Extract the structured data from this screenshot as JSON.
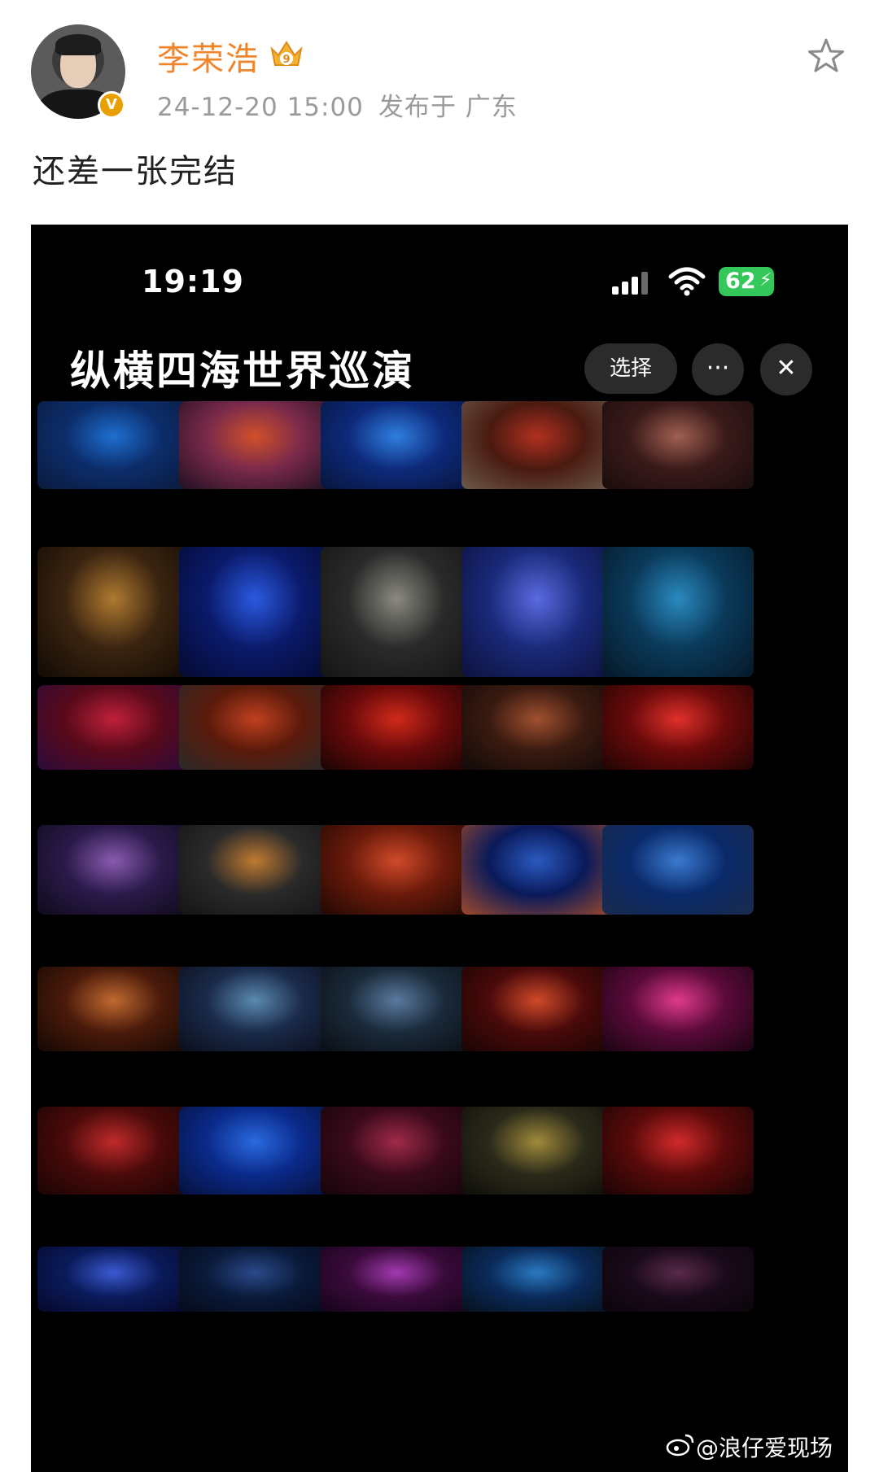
{
  "post": {
    "username": "李荣浩",
    "vip_level": "9",
    "verified_mark": "V",
    "date": "24-12-20 15:00",
    "location": "发布于 广东",
    "text": "还差一张完结"
  },
  "screenshot": {
    "status_time": "19:19",
    "battery": "62",
    "album_title": "纵横四海世界巡演",
    "select_label": "选择",
    "more_label": "···",
    "close_label": "✕",
    "thumbnails": [
      {
        "row": 0,
        "col": 0,
        "colors": [
          "#0c2d6b",
          "#1e6fd0",
          "#0a1a3c"
        ]
      },
      {
        "row": 0,
        "col": 1,
        "colors": [
          "#7a2a4a",
          "#d0502a",
          "#201022"
        ]
      },
      {
        "row": 0,
        "col": 2,
        "colors": [
          "#0d2a7a",
          "#2f7fe0",
          "#08143a"
        ]
      },
      {
        "row": 0,
        "col": 3,
        "colors": [
          "#4a1a10",
          "#b03020",
          "#6a5a4a"
        ]
      },
      {
        "row": 0,
        "col": 4,
        "colors": [
          "#3a1a1a",
          "#a06050",
          "#1a0c0c"
        ]
      },
      {
        "row": 1,
        "col": 0,
        "colors": [
          "#3a2410",
          "#b07a30",
          "#120a04"
        ]
      },
      {
        "row": 1,
        "col": 1,
        "colors": [
          "#0a1a6a",
          "#2a5ae0",
          "#050a30"
        ]
      },
      {
        "row": 1,
        "col": 2,
        "colors": [
          "#2a2a2a",
          "#8a8a80",
          "#141414"
        ]
      },
      {
        "row": 1,
        "col": 3,
        "colors": [
          "#1a2a7a",
          "#5a6ae0",
          "#0c103a"
        ]
      },
      {
        "row": 1,
        "col": 4,
        "colors": [
          "#0a3a5a",
          "#2a8ac0",
          "#061828"
        ]
      },
      {
        "row": 2,
        "col": 0,
        "colors": [
          "#5a0a1a",
          "#c0203a",
          "#2a0a3a"
        ]
      },
      {
        "row": 2,
        "col": 1,
        "colors": [
          "#5a1a0a",
          "#c04020",
          "#2a2a2a"
        ]
      },
      {
        "row": 2,
        "col": 2,
        "colors": [
          "#6a0a0a",
          "#d02a1a",
          "#1a0404"
        ]
      },
      {
        "row": 2,
        "col": 3,
        "colors": [
          "#3a1a10",
          "#a05030",
          "#100a08"
        ]
      },
      {
        "row": 2,
        "col": 4,
        "colors": [
          "#6a0a0a",
          "#e0302a",
          "#200404"
        ]
      },
      {
        "row": 3,
        "col": 0,
        "colors": [
          "#2a1a4a",
          "#8a5ab0",
          "#100a1a"
        ]
      },
      {
        "row": 3,
        "col": 1,
        "colors": [
          "#2a2a2a",
          "#c07a30",
          "#141414"
        ]
      },
      {
        "row": 3,
        "col": 2,
        "colors": [
          "#6a1a0a",
          "#d04a2a",
          "#200804"
        ]
      },
      {
        "row": 3,
        "col": 3,
        "colors": [
          "#0a1a5a",
          "#2a5ac0",
          "#a04a2a"
        ]
      },
      {
        "row": 3,
        "col": 4,
        "colors": [
          "#0a2a6a",
          "#3a7ad0",
          "#1a2a4a"
        ]
      },
      {
        "row": 4,
        "col": 0,
        "colors": [
          "#4a1a0a",
          "#c06a30",
          "#140804"
        ]
      },
      {
        "row": 4,
        "col": 1,
        "colors": [
          "#1a2a4a",
          "#5a8ab0",
          "#0a0e1a"
        ]
      },
      {
        "row": 4,
        "col": 2,
        "colors": [
          "#1a2a3a",
          "#5a7aa0",
          "#0a0e14"
        ]
      },
      {
        "row": 4,
        "col": 3,
        "colors": [
          "#4a0a0a",
          "#d04a2a",
          "#1a0404"
        ]
      },
      {
        "row": 4,
        "col": 4,
        "colors": [
          "#5a0a3a",
          "#e03a8a",
          "#1a0410"
        ]
      },
      {
        "row": 5,
        "col": 0,
        "colors": [
          "#4a0a0a",
          "#c02a2a",
          "#1a0404"
        ]
      },
      {
        "row": 5,
        "col": 1,
        "colors": [
          "#0a2a8a",
          "#2a6ae0",
          "#06103a"
        ]
      },
      {
        "row": 5,
        "col": 2,
        "colors": [
          "#3a0a1a",
          "#a02a4a",
          "#14040a"
        ]
      },
      {
        "row": 5,
        "col": 3,
        "colors": [
          "#2a2a1a",
          "#a08a3a",
          "#0e0e0a"
        ]
      },
      {
        "row": 5,
        "col": 4,
        "colors": [
          "#5a0a0a",
          "#d02a2a",
          "#1a0404"
        ]
      },
      {
        "row": 6,
        "col": 0,
        "colors": [
          "#0a1a5a",
          "#3a5ad0",
          "#06082a"
        ]
      },
      {
        "row": 6,
        "col": 1,
        "colors": [
          "#0a1a3a",
          "#2a4a8a",
          "#060a1a"
        ]
      },
      {
        "row": 6,
        "col": 2,
        "colors": [
          "#3a0a3a",
          "#a03ab0",
          "#14041a"
        ]
      },
      {
        "row": 6,
        "col": 3,
        "colors": [
          "#0a2a5a",
          "#2a7ac0",
          "#06101a"
        ]
      },
      {
        "row": 6,
        "col": 4,
        "colors": [
          "#1a0a1a",
          "#5a2a4a",
          "#0a040a"
        ]
      }
    ]
  },
  "watermark": {
    "text": "@浪仔爱现场"
  }
}
